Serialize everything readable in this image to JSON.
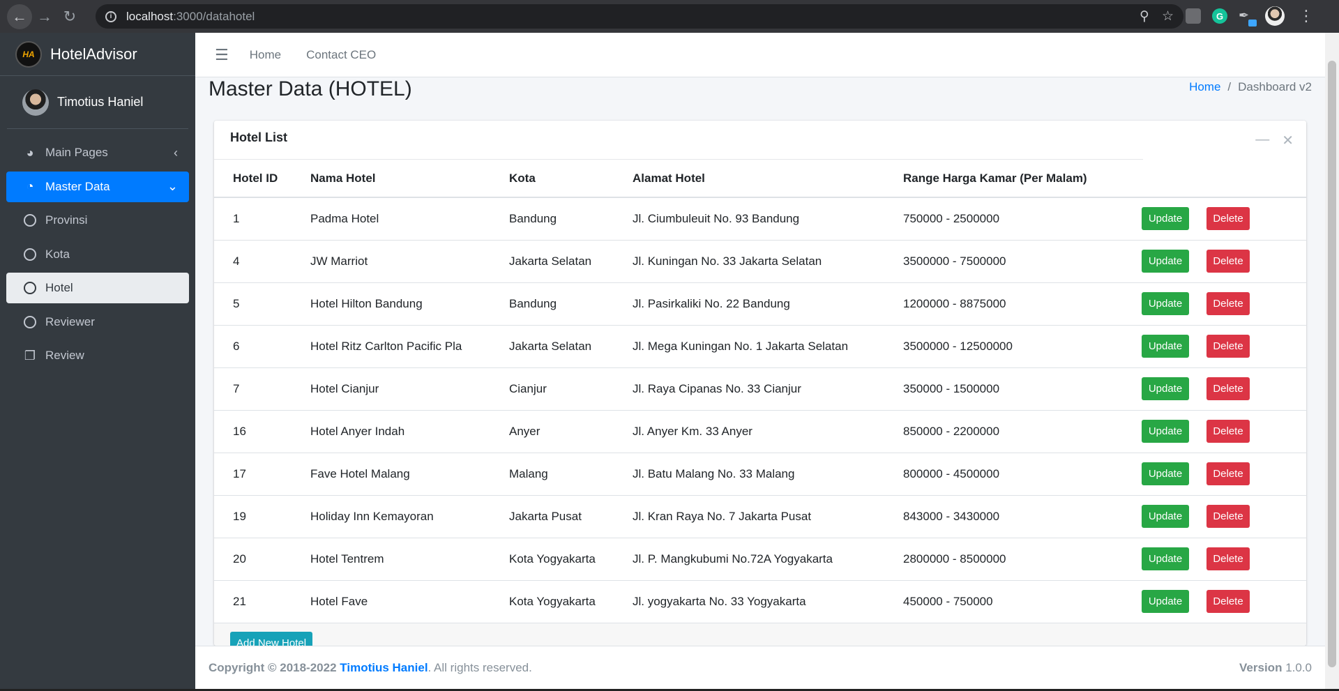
{
  "browser": {
    "url_host": "localhost",
    "url_path": ":3000/datahotel"
  },
  "brand": {
    "name": "HotelAdvisor",
    "logo_text": "HA"
  },
  "user": {
    "name": "Timotius Haniel"
  },
  "sidebar": {
    "items": [
      {
        "label": "Main Pages"
      },
      {
        "label": "Master Data"
      },
      {
        "label": "Provinsi"
      },
      {
        "label": "Kota"
      },
      {
        "label": "Hotel"
      },
      {
        "label": "Reviewer"
      },
      {
        "label": "Review"
      }
    ]
  },
  "topnav": {
    "home": "Home",
    "contact": "Contact CEO"
  },
  "page": {
    "title": "Master Data (HOTEL)",
    "breadcrumb": {
      "home": "Home",
      "sep": "/",
      "current": "Dashboard v2"
    }
  },
  "card": {
    "title": "Hotel List",
    "columns": [
      "Hotel ID",
      "Nama Hotel",
      "Kota",
      "Alamat Hotel",
      "Range Harga Kamar (Per Malam)"
    ],
    "rows": [
      {
        "id": "1",
        "nama": "Padma Hotel",
        "kota": "Bandung",
        "alamat": "Jl. Ciumbuleuit No. 93 Bandung",
        "harga": "750000 - 2500000"
      },
      {
        "id": "4",
        "nama": "JW Marriot",
        "kota": "Jakarta Selatan",
        "alamat": "Jl. Kuningan No. 33 Jakarta Selatan",
        "harga": "3500000 - 7500000"
      },
      {
        "id": "5",
        "nama": "Hotel Hilton Bandung",
        "kota": "Bandung",
        "alamat": "Jl. Pasirkaliki No. 22 Bandung",
        "harga": "1200000 - 8875000"
      },
      {
        "id": "6",
        "nama": "Hotel Ritz Carlton Pacific Pla",
        "kota": "Jakarta Selatan",
        "alamat": "Jl. Mega Kuningan No. 1 Jakarta Selatan",
        "harga": "3500000 - 12500000"
      },
      {
        "id": "7",
        "nama": "Hotel Cianjur",
        "kota": "Cianjur",
        "alamat": "Jl. Raya Cipanas No. 33 Cianjur",
        "harga": "350000 - 1500000"
      },
      {
        "id": "16",
        "nama": "Hotel Anyer Indah",
        "kota": "Anyer",
        "alamat": "Jl. Anyer Km. 33 Anyer",
        "harga": "850000 - 2200000"
      },
      {
        "id": "17",
        "nama": "Fave Hotel Malang",
        "kota": "Malang",
        "alamat": "Jl. Batu Malang No. 33 Malang",
        "harga": "800000 - 4500000"
      },
      {
        "id": "19",
        "nama": "Holiday Inn Kemayoran",
        "kota": "Jakarta Pusat",
        "alamat": "Jl. Kran Raya No. 7 Jakarta Pusat",
        "harga": "843000 - 3430000"
      },
      {
        "id": "20",
        "nama": "Hotel Tentrem",
        "kota": "Kota Yogyakarta",
        "alamat": "Jl. P. Mangkubumi No.72A Yogyakarta",
        "harga": "2800000 - 8500000"
      },
      {
        "id": "21",
        "nama": "Hotel Fave",
        "kota": "Kota Yogyakarta",
        "alamat": "Jl. yogyakarta No. 33 Yogyakarta",
        "harga": "450000 - 750000"
      }
    ],
    "update_label": "Update",
    "delete_label": "Delete",
    "add_label": "Add New Hotel"
  },
  "footer": {
    "copyright_prefix": "Copyright © 2018-2022",
    "author": "Timotius Haniel",
    "rights": ". All rights reserved.",
    "version_label": "Version",
    "version": "1.0.0"
  },
  "colors": {
    "sidebar_bg": "#343a40",
    "active": "#007bff",
    "update": "#28a745",
    "delete": "#dc3545",
    "add": "#17a2b8"
  }
}
